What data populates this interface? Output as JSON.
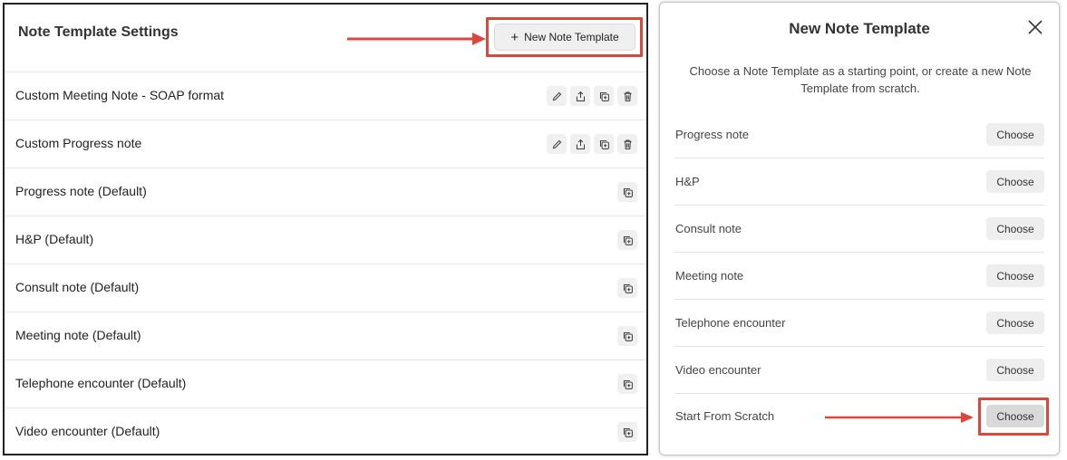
{
  "left": {
    "title": "Note Template Settings",
    "new_button_label": "New Note Template",
    "templates": [
      {
        "name": "Custom Meeting Note - SOAP format",
        "custom": true
      },
      {
        "name": "Custom Progress note",
        "custom": true
      },
      {
        "name": "Progress note (Default)",
        "custom": false
      },
      {
        "name": "H&P (Default)",
        "custom": false
      },
      {
        "name": "Consult note (Default)",
        "custom": false
      },
      {
        "name": "Meeting note (Default)",
        "custom": false
      },
      {
        "name": "Telephone encounter (Default)",
        "custom": false
      },
      {
        "name": "Video encounter (Default)",
        "custom": false
      }
    ]
  },
  "modal": {
    "title": "New Note Template",
    "description": "Choose a Note Template as a starting point, or create a new Note Template from scratch.",
    "choose_label": "Choose",
    "options": [
      "Progress note",
      "H&P",
      "Consult note",
      "Meeting note",
      "Telephone encounter",
      "Video encounter",
      "Start From Scratch"
    ]
  },
  "colors": {
    "highlight": "#d9483b",
    "button_bg": "#eeeeee"
  }
}
